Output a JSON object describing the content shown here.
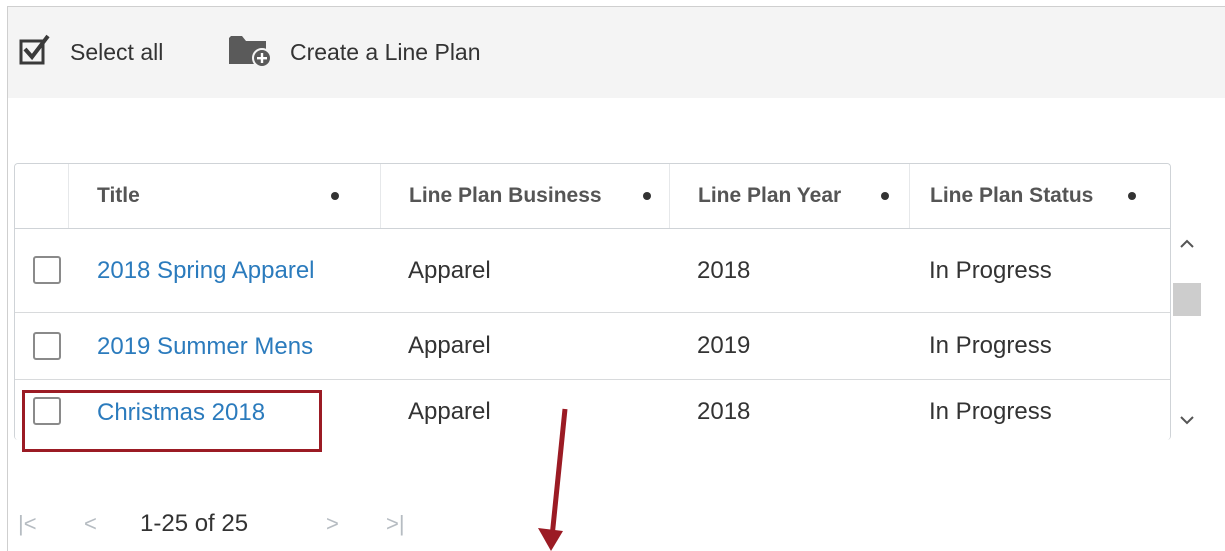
{
  "toolbar": {
    "select_all_label": "Select all",
    "create_label": "Create a Line Plan"
  },
  "grid": {
    "columns": [
      {
        "label": "Title"
      },
      {
        "label": "Line Plan Business"
      },
      {
        "label": "Line Plan Year"
      },
      {
        "label": "Line Plan Status"
      }
    ],
    "rows": [
      {
        "title": "2018 Spring Apparel",
        "business": "Apparel",
        "year": "2018",
        "status": "In Progress",
        "checked": false
      },
      {
        "title": "2019 Summer Mens",
        "business": "Apparel",
        "year": "2019",
        "status": "In Progress",
        "checked": false
      },
      {
        "title": "Christmas 2018",
        "business": "Apparel",
        "year": "2018",
        "status": "In Progress",
        "checked": false
      }
    ]
  },
  "pager": {
    "range_text": "1-25 of 25",
    "first_glyph": "|<",
    "prev_glyph": "<",
    "next_glyph": ">",
    "last_glyph": ">|"
  },
  "colors": {
    "link": "#2b7bbd",
    "highlight": "#9b1b24",
    "toolbar_bg": "#f4f4f4"
  },
  "icons": {
    "select_all": "checkbox-checked-icon",
    "create": "folder-add-icon"
  }
}
